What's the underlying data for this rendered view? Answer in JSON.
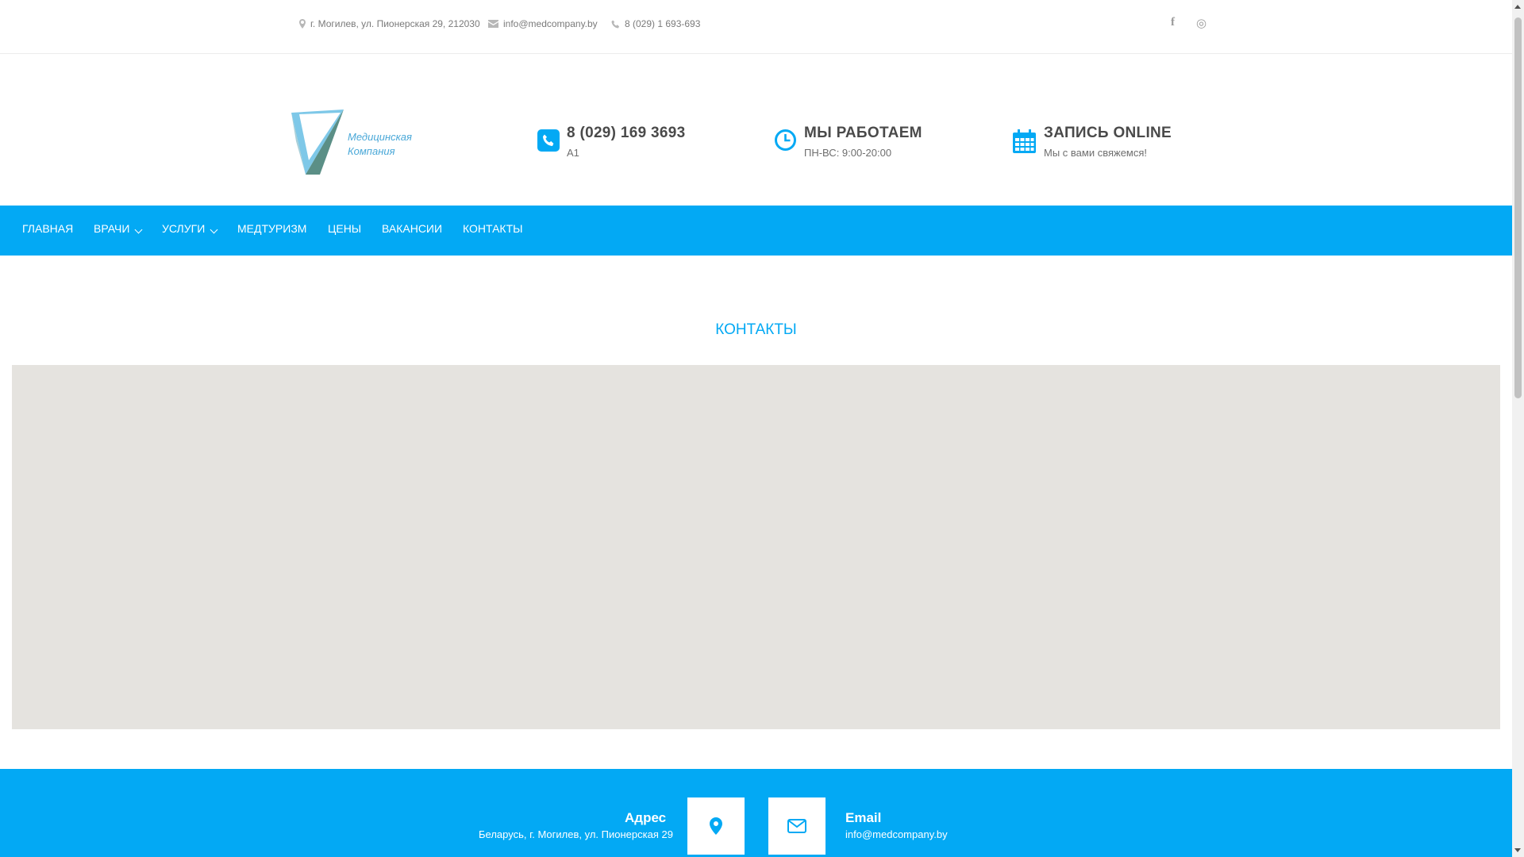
{
  "topbar": {
    "address": "г. Могилев, ул. Пионерская 29, 212030",
    "email": "info@medcompany.by",
    "phone": "8 (029) 1 693-693",
    "social_facebook": "f",
    "social_instagram": "◎"
  },
  "logo": {
    "line1": "Медицинская",
    "line2": "Компания",
    "icon": "logo-mark"
  },
  "header": {
    "phone_title": "8 (029) 169 3693",
    "phone_sub": "A1",
    "hours_title": "МЫ РАБОТАЕМ",
    "hours_sub": "ПН-ВС: 9:00-20:00",
    "booking_title": "ЗАПИСЬ ONLINE",
    "booking_sub": "Мы с вами свяжемся!"
  },
  "nav": {
    "items": [
      {
        "label": "ГЛАВНАЯ"
      },
      {
        "label": "ВРАЧИ"
      },
      {
        "label": "УСЛУГИ"
      },
      {
        "label": "МЕДТУРИЗМ"
      },
      {
        "label": "ЦЕНЫ"
      },
      {
        "label": "ВАКАНСИИ"
      },
      {
        "label": "КОНТАКТЫ"
      }
    ]
  },
  "main": {
    "title": "КОНТАКТЫ"
  },
  "footer": {
    "address_label": "Адрес",
    "address_value": "Беларусь, г. Могилев, ул. Пионерская 29",
    "email_label": "Email",
    "email_value": "info@medcompany.by"
  },
  "colors": {
    "accent": "#03a9f4",
    "map_bg": "#e5e3df",
    "text_dark": "#4a4a4a"
  }
}
